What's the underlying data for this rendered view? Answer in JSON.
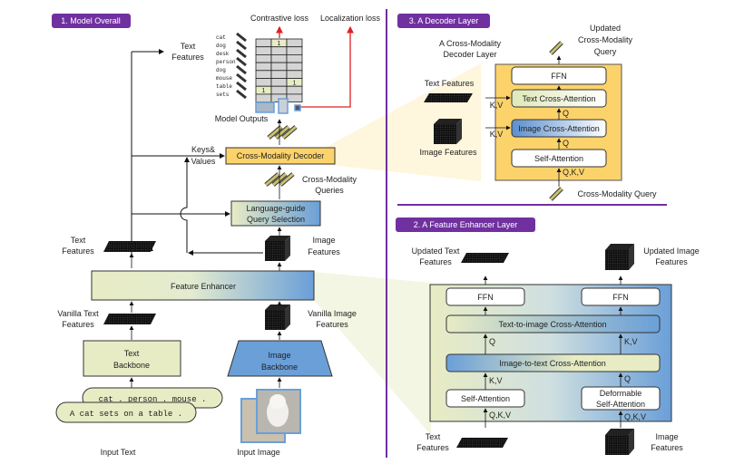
{
  "panel1": {
    "title": "1. Model Overall",
    "losses": {
      "contrastive": "Contrastive loss",
      "localization": "Localization loss"
    },
    "text_features_top": [
      "Text",
      "Features"
    ],
    "tokens": [
      "cat",
      "dog",
      "desk",
      "person",
      "dog",
      "mouse",
      "table",
      "sets"
    ],
    "grid": {
      "rows": 8,
      "cols": 3,
      "ones": [
        [
          0,
          1
        ],
        [
          5,
          2
        ],
        [
          6,
          0
        ]
      ],
      "one_label": "1"
    },
    "model_outputs": "Model Outputs",
    "keys_values": [
      "Keys&",
      "Values"
    ],
    "decoder": "Cross-Modality Decoder",
    "queries": [
      "Cross-Modality",
      "Queries"
    ],
    "query_selection": [
      "Language-guide",
      "Query Selection"
    ],
    "text_features": [
      "Text",
      "Features"
    ],
    "image_features": [
      "Image",
      "Features"
    ],
    "feature_enhancer": "Feature Enhancer",
    "vanilla_text": [
      "Vanilla Text",
      "Features"
    ],
    "vanilla_image": [
      "Vanilla Image",
      "Features"
    ],
    "text_backbone": [
      "Text",
      "Backbone"
    ],
    "image_backbone": [
      "Image",
      "Backbone"
    ],
    "prompt_1": "cat . person . mouse .",
    "prompt_2": "A cat sets on a table .",
    "input_text": "Input Text",
    "input_image": "Input Image"
  },
  "panel3": {
    "title": "3. A Decoder Layer",
    "layer_label": [
      "A Cross-Modality",
      "Decoder Layer"
    ],
    "updated_query": [
      "Updated",
      "Cross-Modality",
      "Query"
    ],
    "text_features": "Text Features",
    "image_features": "Image Features",
    "blocks": [
      "FFN",
      "Text Cross-Attention",
      "Image Cross-Attention",
      "Self-Attention"
    ],
    "kv": "K,V",
    "q": "Q",
    "qkv": "Q,K,V",
    "input_query": "Cross-Modality Query"
  },
  "panel2": {
    "title": "2. A Feature Enhancer Layer",
    "updated_text": [
      "Updated Text",
      "Features"
    ],
    "updated_image": [
      "Updated Image",
      "Features"
    ],
    "ffn": "FFN",
    "t2i": "Text-to-image Cross-Attention",
    "i2t": "Image-to-text Cross-Attention",
    "self_attn": "Self-Attention",
    "deform": [
      "Deformable",
      "Self-Attention"
    ],
    "q": "Q",
    "kv": "K,V",
    "qkv": "Q,K,V",
    "text_features": [
      "Text",
      "Features"
    ],
    "image_features": [
      "Image",
      "Features"
    ]
  },
  "colors": {
    "purple": "#7030a0",
    "yellow": "#fcd36b",
    "yellow_bg": "#fbe3a0",
    "green": "#e8ecc4",
    "blue": "#6a9fd8",
    "red": "#e02020"
  }
}
